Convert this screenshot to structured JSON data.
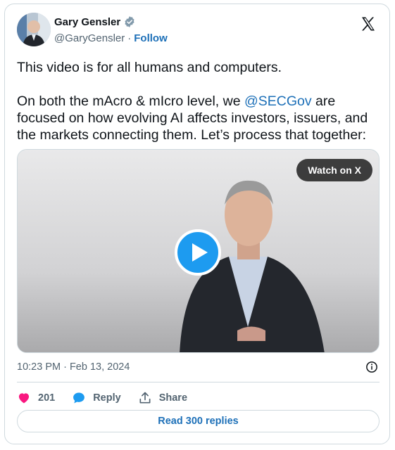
{
  "author": {
    "display_name": "Gary Gensler",
    "handle": "@GaryGensler",
    "separator": "·",
    "follow_label": "Follow",
    "verified_icon": "verified-badge-icon"
  },
  "tweet": {
    "line1": "This video is for all humans and computers.",
    "para2_before": "On both the mAcro & mIcro level, we ",
    "mention": "@SECGov",
    "para2_after": " are focused on how evolving AI affects investors, issuers, and the markets connecting them. Let’s process that together:"
  },
  "media": {
    "watch_label": "Watch on X"
  },
  "timestamp": "10:23 PM · Feb 13, 2024",
  "actions": {
    "likes": "201",
    "reply_label": "Reply",
    "share_label": "Share"
  },
  "read_replies_label": "Read 300 replies",
  "colors": {
    "like": "#f91880",
    "accent": "#1d9bf0",
    "link": "#1d70b8"
  }
}
